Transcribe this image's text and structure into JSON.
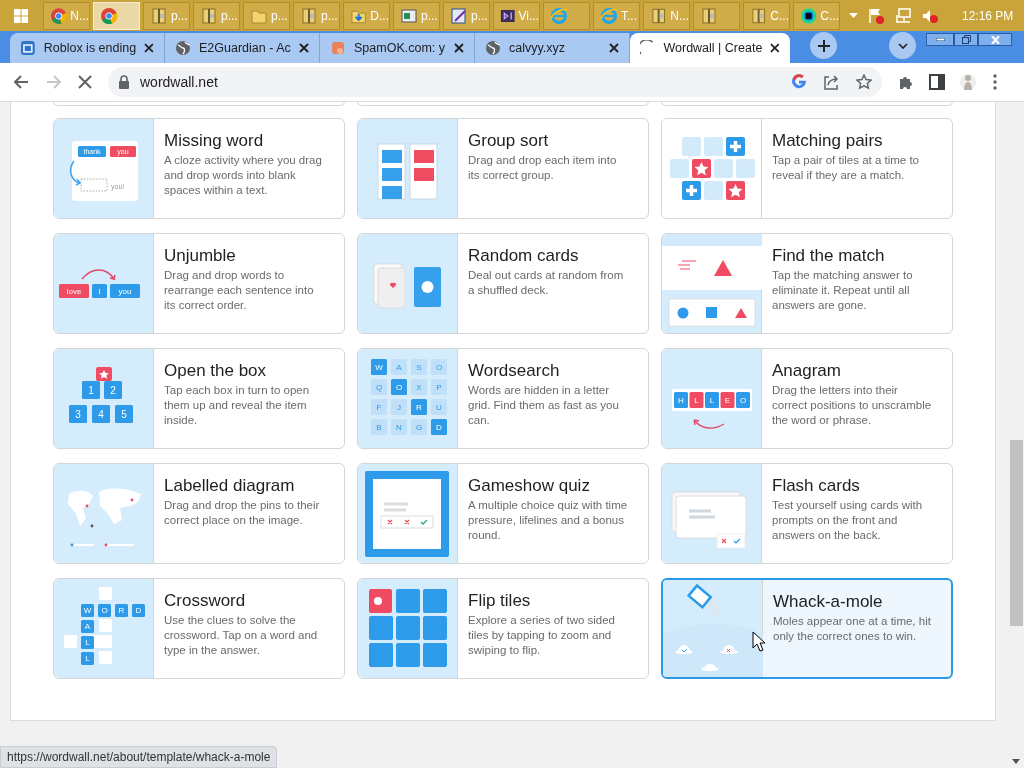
{
  "taskbar": {
    "items": [
      {
        "kind": "chrome",
        "label": "N...",
        "selected": false
      },
      {
        "kind": "chrome",
        "selected": true
      },
      {
        "kind": "archive",
        "label": "p...",
        "selected": false
      },
      {
        "kind": "archive",
        "label": "p...",
        "selected": false
      },
      {
        "kind": "folder",
        "label": "p...",
        "selected": false
      },
      {
        "kind": "archive",
        "label": "p...",
        "selected": false
      },
      {
        "kind": "download",
        "label": "D...",
        "selected": false
      },
      {
        "kind": "image",
        "label": "p...",
        "selected": false
      },
      {
        "kind": "editor",
        "label": "p...",
        "selected": false
      },
      {
        "kind": "studio",
        "label": "Vi...",
        "selected": false
      },
      {
        "kind": "ie",
        "selected": false
      },
      {
        "kind": "ie",
        "label": "T...",
        "selected": false
      },
      {
        "kind": "archive",
        "label": "N...",
        "selected": false
      },
      {
        "kind": "archive",
        "selected": false
      },
      {
        "kind": "archive",
        "label": "C...",
        "selected": false
      },
      {
        "kind": "charm",
        "label": "C...",
        "selected": false
      }
    ],
    "clock": "12:16 PM"
  },
  "browser": {
    "tabs": [
      {
        "title": "Roblox is ending",
        "kind": "square",
        "selected": false
      },
      {
        "title": "E2Guardian - Ac",
        "kind": "globe",
        "selected": false
      },
      {
        "title": "SpamOK.com: y",
        "kind": "spam",
        "selected": false
      },
      {
        "title": "calvyy.xyz",
        "kind": "globe",
        "selected": false
      },
      {
        "title": "Wordwall | Create",
        "kind": "loading",
        "selected": true
      }
    ],
    "url": "wordwall.net",
    "status_url": "https://wordwall.net/about/template/whack-a-mole"
  },
  "templates": [
    {
      "title": "Missing word",
      "description": "A cloze activity where you drag and drop words into blank spaces within a text.",
      "art": {
        "kind": "missing",
        "tiles": [
          {
            "text": "thank",
            "color": "#2d9bea"
          },
          {
            "text": "you",
            "color": "#ef4c63"
          }
        ],
        "label": "you!"
      },
      "selected": false
    },
    {
      "title": "Group sort",
      "description": "Drag and drop each item into its correct group.",
      "art": {
        "kind": "groupsort"
      },
      "selected": false
    },
    {
      "title": "Matching pairs",
      "description": "Tap a pair of tiles at a time to reveal if they are a match.",
      "art": {
        "kind": "matching"
      },
      "selected": false
    },
    {
      "title": "Unjumble",
      "description": "Drag and drop words to rearrange each sentence into its correct order.",
      "art": {
        "kind": "unjumble",
        "tiles": [
          {
            "text": "love",
            "color": "#ef4c63"
          },
          {
            "text": "I",
            "color": "#2d9bea"
          },
          {
            "text": "you",
            "color": "#2d9bea"
          }
        ]
      },
      "selected": false
    },
    {
      "title": "Random cards",
      "description": "Deal out cards at random from a shuffled deck.",
      "art": {
        "kind": "cards"
      },
      "selected": false
    },
    {
      "title": "Find the match",
      "description": "Tap the matching answer to eliminate it. Repeat until all answers are gone.",
      "art": {
        "kind": "findmatch"
      },
      "selected": false
    },
    {
      "title": "Open the box",
      "description": "Tap each box in turn to open them up and reveal the item inside.",
      "art": {
        "kind": "boxes",
        "tiles": [
          {
            "text": "1",
            "color": "#2d9bea"
          },
          {
            "text": "2",
            "color": "#2d9bea"
          },
          {
            "text": "3",
            "color": "#2d9bea"
          },
          {
            "text": "4",
            "color": "#2d9bea"
          },
          {
            "text": "5",
            "color": "#2d9bea"
          }
        ]
      },
      "selected": false
    },
    {
      "title": "Wordsearch",
      "description": "Words are hidden in a letter grid. Find them as fast as you can.",
      "art": {
        "kind": "wordsearch",
        "tiles": [
          {
            "text": "W",
            "color": "#2d9bea"
          },
          {
            "text": "A",
            "color": "#bfe0f8"
          },
          {
            "text": "S",
            "color": "#bfe0f8"
          },
          {
            "text": "O",
            "color": "#bfe0f8"
          },
          {
            "text": "Q",
            "color": "#bfe0f8"
          },
          {
            "text": "O",
            "color": "#2d9bea"
          },
          {
            "text": "X",
            "color": "#bfe0f8"
          },
          {
            "text": "P",
            "color": "#bfe0f8"
          },
          {
            "text": "F",
            "color": "#bfe0f8"
          },
          {
            "text": "J",
            "color": "#bfe0f8"
          },
          {
            "text": "R",
            "color": "#2d9bea"
          },
          {
            "text": "U",
            "color": "#bfe0f8"
          },
          {
            "text": "B",
            "color": "#bfe0f8"
          },
          {
            "text": "N",
            "color": "#bfe0f8"
          },
          {
            "text": "G",
            "color": "#bfe0f8"
          },
          {
            "text": "D",
            "color": "#2d9bea"
          }
        ]
      },
      "selected": false
    },
    {
      "title": "Anagram",
      "description": "Drag the letters into their correct positions to unscramble the word or phrase.",
      "art": {
        "kind": "anagram",
        "tiles": [
          {
            "text": "H",
            "color": "#2d9bea"
          },
          {
            "text": "L",
            "color": "#ef4c63"
          },
          {
            "text": "L",
            "color": "#2d9bea"
          },
          {
            "text": "E",
            "color": "#ef4c63"
          },
          {
            "text": "O",
            "color": "#2d9bea"
          }
        ]
      },
      "selected": false
    },
    {
      "title": "Labelled diagram",
      "description": "Drag and drop the pins to their correct place on the image.",
      "art": {
        "kind": "map"
      },
      "selected": false
    },
    {
      "title": "Gameshow quiz",
      "description": "A multiple choice quiz with time pressure, lifelines and a bonus round.",
      "art": {
        "kind": "gameshow"
      },
      "selected": false
    },
    {
      "title": "Flash cards",
      "description": "Test yourself using cards with prompts on the front and answers on the back.",
      "art": {
        "kind": "flash"
      },
      "selected": false
    },
    {
      "title": "Crossword",
      "description": "Use the clues to solve the crossword. Tap on a word and type in the answer.",
      "art": {
        "kind": "crossword",
        "tiles": [
          {
            "text": "W",
            "color": "#2d9bea"
          },
          {
            "text": "O",
            "color": "#2d9bea"
          },
          {
            "text": "R",
            "color": "#2d9bea"
          },
          {
            "text": "D",
            "color": "#2d9bea"
          },
          {
            "text": "A",
            "color": "#2d9bea"
          },
          {
            "text": "L",
            "color": "#2d9bea"
          },
          {
            "text": "L",
            "color": "#2d9bea"
          }
        ]
      },
      "selected": false
    },
    {
      "title": "Flip tiles",
      "description": "Explore a series of two sided tiles by tapping to zoom and swiping to flip.",
      "art": {
        "kind": "fliptiles"
      },
      "selected": false
    },
    {
      "title": "Whack-a-mole",
      "description": "Moles appear one at a time, hit only the correct ones to win.",
      "art": {
        "kind": "whack"
      },
      "selected": true
    }
  ]
}
